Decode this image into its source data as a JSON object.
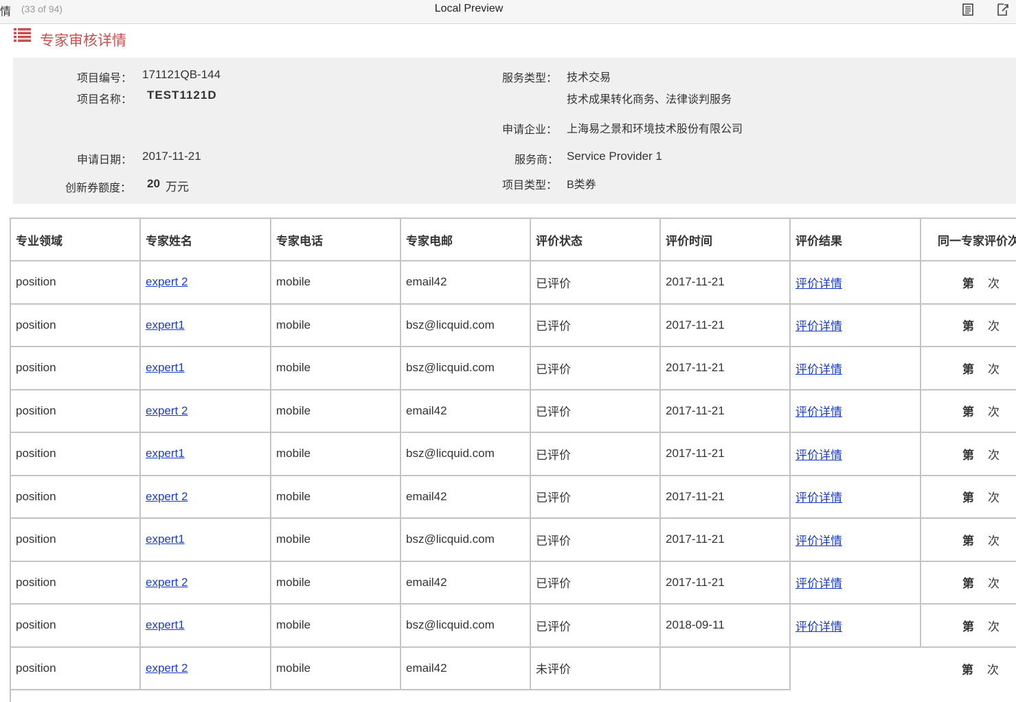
{
  "topbar": {
    "tab_title": "情",
    "tab_count": "(33 of 94)",
    "window_title": "Local Preview",
    "icons": [
      "document-icon",
      "external-link-icon"
    ]
  },
  "section": {
    "title": "专家审核详情",
    "icon": "list-icon",
    "color": "#c7514f"
  },
  "info": {
    "project_no_label": "项目编号：",
    "project_no": "171121QB-144",
    "project_name_label": "项目名称：",
    "project_name": "TEST1121D",
    "apply_date_label": "申请日期：",
    "apply_date": "2017-11-21",
    "voucher_label": "创新券额度：",
    "voucher_amount": "20",
    "voucher_unit": "万元",
    "service_type_label": "服务类型：",
    "service_type": "技术交易",
    "service_type_detail": "技术成果转化商务、法律谈判服务",
    "company_label": "申请企业：",
    "company": "上海易之景和环境技术股份有限公司",
    "provider_label": "服务商：",
    "provider": "Service Provider 1",
    "project_type_label": "项目类型：",
    "project_type": "B类券"
  },
  "table": {
    "headers": [
      "专业领域",
      "专家姓名",
      "专家电话",
      "专家电邮",
      "评价状态",
      "评价时间",
      "评价结果",
      "同一专家评价次"
    ],
    "rows": [
      {
        "field": "position",
        "name": "expert 2",
        "phone": "mobile",
        "email": "email42",
        "status": "已评价",
        "time": "2017-11-21",
        "result": "评价详情",
        "nth_a": "第",
        "nth_b": "次"
      },
      {
        "field": "position",
        "name": "expert1",
        "phone": "mobile",
        "email": "bsz@licquid.com",
        "status": "已评价",
        "time": "2017-11-21",
        "result": "评价详情",
        "nth_a": "第",
        "nth_b": "次"
      },
      {
        "field": "position",
        "name": "expert1",
        "phone": "mobile",
        "email": "bsz@licquid.com",
        "status": "已评价",
        "time": "2017-11-21",
        "result": "评价详情",
        "nth_a": "第",
        "nth_b": "次"
      },
      {
        "field": "position",
        "name": "expert 2",
        "phone": "mobile",
        "email": "email42",
        "status": "已评价",
        "time": "2017-11-21",
        "result": "评价详情",
        "nth_a": "第",
        "nth_b": "次"
      },
      {
        "field": "position",
        "name": "expert1",
        "phone": "mobile",
        "email": "bsz@licquid.com",
        "status": "已评价",
        "time": "2017-11-21",
        "result": "评价详情",
        "nth_a": "第",
        "nth_b": "次"
      },
      {
        "field": "position",
        "name": "expert 2",
        "phone": "mobile",
        "email": "email42",
        "status": "已评价",
        "time": "2017-11-21",
        "result": "评价详情",
        "nth_a": "第",
        "nth_b": "次"
      },
      {
        "field": "position",
        "name": "expert1",
        "phone": "mobile",
        "email": "bsz@licquid.com",
        "status": "已评价",
        "time": "2017-11-21",
        "result": "评价详情",
        "nth_a": "第",
        "nth_b": "次"
      },
      {
        "field": "position",
        "name": "expert 2",
        "phone": "mobile",
        "email": "email42",
        "status": "已评价",
        "time": "2017-11-21",
        "result": "评价详情",
        "nth_a": "第",
        "nth_b": "次"
      },
      {
        "field": "position",
        "name": "expert1",
        "phone": "mobile",
        "email": "bsz@licquid.com",
        "status": "已评价",
        "time": "2018-09-11",
        "result": "评价详情",
        "nth_a": "第",
        "nth_b": "次"
      },
      {
        "field": "position",
        "name": "expert 2",
        "phone": "mobile",
        "email": "email42",
        "status": "未评价",
        "time": "",
        "result": "",
        "nth_a": "第",
        "nth_b": "次"
      }
    ]
  },
  "colors": {
    "link": "#1a3ccd",
    "accent": "#c7514f",
    "panel": "#f0f0f0",
    "border": "#c4c4c4"
  }
}
